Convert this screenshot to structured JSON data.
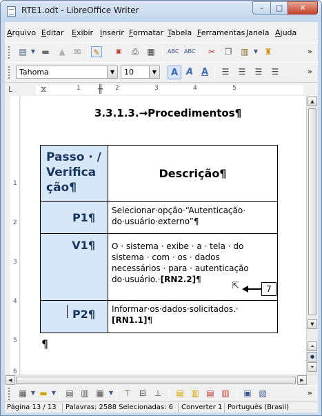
{
  "window": {
    "title": "RTE1.odt - LibreOffice Writer",
    "minimize": "–",
    "maximize": "□",
    "close": "✕"
  },
  "menubar": {
    "items": [
      "Arquivo",
      "Editar",
      "Exibir",
      "Inserir",
      "Formatar",
      "Tabela",
      "Ferramentas",
      "Janela",
      "Ajuda"
    ]
  },
  "standard_toolbar": {
    "icons": [
      "new-document-icon",
      "open-folder-icon",
      "save-icon",
      "email-icon",
      "edit-mode-icon",
      "export-pdf-icon",
      "print-icon",
      "print-preview-icon",
      "spellcheck-icon",
      "autospellcheck-icon",
      "cut-icon",
      "copy-icon",
      "paste-icon",
      "clone-formatting-icon"
    ],
    "more": "»"
  },
  "formatting_toolbar": {
    "font_name": "Tahoma",
    "font_size": "10",
    "more": "»"
  },
  "ruler": {
    "numbers": [
      "1",
      "2",
      "3",
      "4",
      "5"
    ],
    "tab_marker": "L"
  },
  "vertical_ruler": {
    "numbers": [
      "1",
      "2",
      "3",
      "4",
      "5",
      "6"
    ]
  },
  "document": {
    "heading": "3.3.1.3.→Procedimentos¶",
    "table": {
      "header_left": "Passo · / Verifica ção¶",
      "header_left_lines": [
        "Passo · /",
        "Verifica",
        "ção¶"
      ],
      "header_right": "Descrição¶",
      "rows": [
        {
          "step": "P1¶",
          "desc_lines": [
            "Selecionar·opção·“Autenticação·",
            "do·usuário·externo”¶"
          ]
        },
        {
          "step": "V1¶",
          "desc_lines": [
            "O · sistema · exibe · a · tela · do",
            "sistema · com · os · dados",
            "necessários · para · autenticação",
            "do·usuário.·"
          ],
          "req": "[RN2.2]",
          "req_end": "¶"
        },
        {
          "step": "P2¶",
          "desc_lines": [
            "Informar·os·dados·solicitados.·"
          ],
          "req": "[RN1.1]",
          "req_end": "¶"
        }
      ]
    },
    "callout_number": "7",
    "trailing_paragraph": "¶"
  },
  "statusbar": {
    "page": "Página 13 / 13",
    "words": "Palavras: 2588 Selecionadas: 6",
    "mode": "Converter 1",
    "language": "Português (Brasil)"
  }
}
